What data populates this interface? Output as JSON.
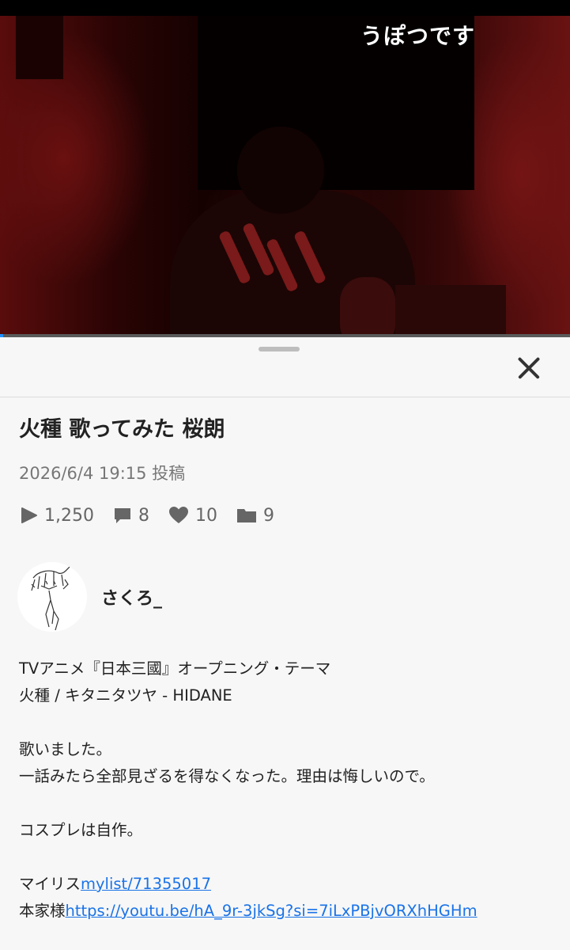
{
  "video": {
    "caption": "うぽつです",
    "progress_percent": 0.5
  },
  "sheet": {
    "close_icon": "close-icon"
  },
  "post": {
    "title": "火種 歌ってみた 桜朗",
    "posted": "2026/6/4 19:15 投稿",
    "stats": {
      "views": "1,250",
      "comments": "8",
      "likes": "10",
      "mylists": "9"
    }
  },
  "author": {
    "name": "さくろ_"
  },
  "description": {
    "line1": "TVアニメ『日本三國』オープニング・テーマ",
    "line2": "火種 / キタニタツヤ - HIDANE",
    "line3": "歌いました。",
    "line4": "一話みたら全部見ざるを得なくなった。理由は悔しいので。",
    "line5": "コスプレは自作。",
    "mylist_label": "マイリス",
    "mylist_link": "mylist/71355017",
    "origin_label": "本家様",
    "origin_link": "https://youtu.be/hA_9r-3jkSg?si=7iLxPBjvORXhHGHm"
  },
  "colors": {
    "link": "#1a73e8",
    "progress": "#1e90ff",
    "background": "#f7f7f7"
  }
}
